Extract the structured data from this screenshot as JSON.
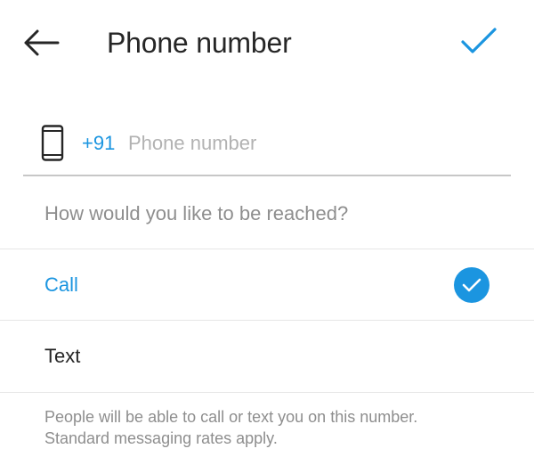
{
  "header": {
    "title": "Phone number",
    "back_icon": "arrow-left-icon",
    "confirm_icon": "checkmark-icon"
  },
  "phone": {
    "country_code": "+91",
    "placeholder": "Phone number",
    "value": "",
    "icon": "mobile-phone-icon"
  },
  "contact": {
    "question": "How would you like to be reached?",
    "options": [
      {
        "label": "Call",
        "selected": true
      },
      {
        "label": "Text",
        "selected": false
      }
    ]
  },
  "footnote": {
    "line1": "People will be able to call or text you on this number.",
    "line2": "Standard messaging rates apply."
  },
  "colors": {
    "accent": "#1b95e0",
    "text": "#262626",
    "muted": "#8e8e8e",
    "divider": "#e6e6e6"
  }
}
